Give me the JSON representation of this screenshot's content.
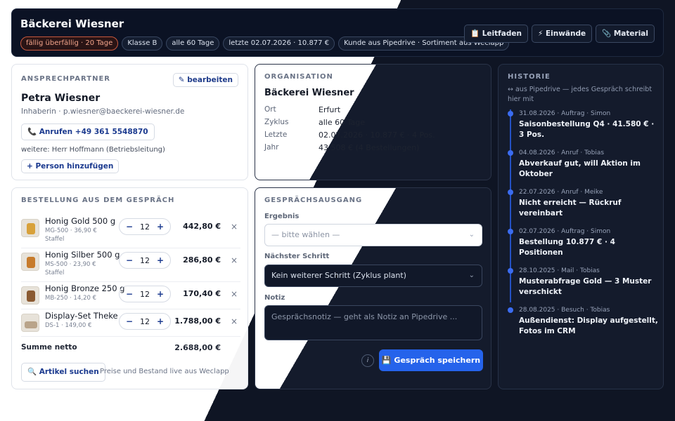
{
  "header": {
    "title": "Bäckerei Wiesner",
    "chips": [
      "fällig überfällig · 20 Tage",
      "Klasse B",
      "alle 60 Tage",
      "letzte 02.07.2026 · 10.877 €",
      "Kunde aus Pipedrive · Sortiment aus Weclapp"
    ],
    "actions": [
      "📋 Leitfaden",
      "⚡ Einwände",
      "📎 Material"
    ]
  },
  "contact": {
    "label": "ANSPRECHPARTNER",
    "edit": "✎ bearbeiten",
    "name": "Petra Wiesner",
    "role": "Inhaberin · p.wiesner@baeckerei-wiesner.de",
    "call": "📞 Anrufen +49 361 5548870",
    "more": "weitere: Herr Hoffmann (Betriebsleitung)",
    "add": "+ Person hinzufügen"
  },
  "order": {
    "label": "BESTELLUNG AUS DEM GESPRÄCH",
    "items": [
      {
        "name": "Honig Gold 500 g",
        "sku": "MG-500 · 36,90 €",
        "tier": "Staffel",
        "qty": "12",
        "total": "442,80 €"
      },
      {
        "name": "Honig Silber 500 g",
        "sku": "MS-500 · 23,90 €",
        "tier": "Staffel",
        "qty": "12",
        "total": "286,80 €"
      },
      {
        "name": "Honig Bronze 250 g",
        "sku": "MB-250 · 14,20 €",
        "tier": "",
        "qty": "12",
        "total": "170,40 €"
      },
      {
        "name": "Display-Set Theke",
        "sku": "DS-1 · 149,00 €",
        "tier": "",
        "qty": "12",
        "total": "1.788,00 €"
      }
    ],
    "sum_label": "Summe netto",
    "sum_value": "2.688,00 €",
    "search": "🔍 Artikel suchen",
    "hint": "Preise und Bestand live aus Weclapp",
    "minus": "−",
    "plus": "+",
    "remove": "×"
  },
  "org": {
    "label": "ORGANISATION",
    "name": "Bäckerei Wiesner",
    "rows": [
      {
        "key": "Ort",
        "value": "Erfurt"
      },
      {
        "key": "Zyklus",
        "value": "alle 60 Tage"
      },
      {
        "key": "Letzte",
        "value": "02.07.2026 · 10.877 € · 4 Pos."
      },
      {
        "key": "Jahr",
        "value": "43.508 € (4 Bestellungen)"
      }
    ]
  },
  "outcome": {
    "label": "GESPRÄCHSAUSGANG",
    "result_label": "Ergebnis",
    "result_value": "— bitte wählen —",
    "next_label": "Nächster Schritt",
    "next_value": "Kein weiterer Schritt (Zyklus plant)",
    "note_label": "Notiz",
    "note_placeholder": "Gesprächsnotiz — geht als Notiz an Pipedrive ...",
    "info": "i",
    "save": "💾 Gespräch speichern",
    "chevron": "⌄"
  },
  "history": {
    "label": "HISTORIE",
    "sub": "↔ aus Pipedrive — jedes Gespräch schreibt hier mit",
    "items": [
      {
        "meta": "31.08.2026 · Auftrag · Simon",
        "text": "Saisonbestellung Q4 · 41.580 € · 3 Pos."
      },
      {
        "meta": "04.08.2026 · Anruf · Tobias",
        "text": "Abverkauf gut, will Aktion im Oktober"
      },
      {
        "meta": "22.07.2026 · Anruf · Meike",
        "text": "Nicht erreicht — Rückruf vereinbart"
      },
      {
        "meta": "02.07.2026 · Auftrag · Simon",
        "text": "Bestellung 10.877 € · 4 Positionen"
      },
      {
        "meta": "28.10.2025 · Mail · Tobias",
        "text": "Musterabfrage Gold — 3 Muster verschickt"
      },
      {
        "meta": "28.08.2025 · Besuch · Tobias",
        "text": "Außendienst: Display aufgestellt, Fotos im CRM"
      }
    ]
  },
  "colors": {
    "accent": "#2563eb",
    "dark_bg": "#0f1524",
    "alert": "#c9593e"
  }
}
